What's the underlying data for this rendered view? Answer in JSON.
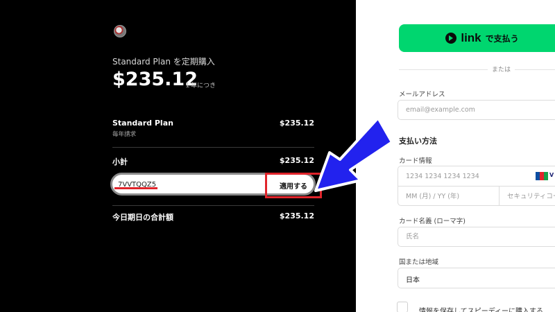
{
  "order": {
    "plan_title": "Standard Plan を定期購入",
    "price": "$235.12",
    "period": "１年につき",
    "line_item_name": "Standard Plan",
    "line_item_sub": "毎年請求",
    "line_item_price": "$235.12",
    "subtotal_label": "小計",
    "subtotal_value": "$235.12",
    "promo_code_value": "7VVTQQZ5",
    "apply_label": "適用する",
    "total_label": "今日期日の合計額",
    "total_value": "$235.12"
  },
  "payment": {
    "link_word": "link",
    "link_text": "で支払う",
    "or_text": "または",
    "email_label": "メールアドレス",
    "email_placeholder": "email@example.com",
    "method_title": "支払い方法",
    "card_label": "カード情報",
    "card_number_placeholder": "1234 1234 1234 1234",
    "card_exp_placeholder": "MM (月) / YY (年)",
    "card_cvc_placeholder": "セキュリティコード",
    "cardholder_label": "カード名義 (ローマ字)",
    "cardholder_placeholder": "氏名",
    "country_label": "国または地域",
    "country_value": "日本",
    "save_label": "情報を保存してスピーディーに購入する"
  },
  "colors": {
    "link_green": "#00d66f",
    "highlight_red": "#e0242b",
    "arrow_blue": "#2222ee"
  }
}
